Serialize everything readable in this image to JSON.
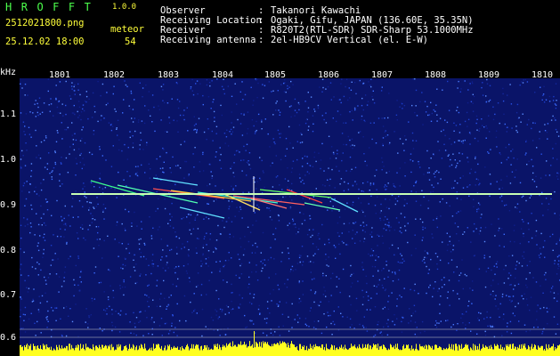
{
  "header": {
    "logo": "HROFFT",
    "version": "1.0.0",
    "filename": "2512021800.png",
    "datetime": "25.12.02 18:00",
    "meteor_label": "meteor",
    "meteor_count": "54",
    "fields": [
      {
        "label": "Observer",
        "value": "Takanori Kawachi"
      },
      {
        "label": "Receiving Location",
        "value": "Ogaki, Gifu, JAPAN (136.60E, 35.35N)"
      },
      {
        "label": "Receiver",
        "value": "R820T2(RTL-SDR) SDR-Sharp 53.1000MHz"
      },
      {
        "label": "Receiving antenna",
        "value": "2el-HB9CV Vertical (el. E-W)"
      }
    ]
  },
  "axis": {
    "unit": "kHz",
    "time_labels": [
      "1801",
      "1802",
      "1803",
      "1804",
      "1805",
      "1806",
      "1807",
      "1808",
      "1809",
      "1810"
    ],
    "freq_labels": [
      "1.1",
      "1.0",
      "0.9",
      "0.8",
      "0.7",
      "0.6"
    ]
  },
  "colors": {
    "background": "#0a1468",
    "carrier": "#c8ffb4",
    "signal_bar": "#ffff20",
    "label_text": "#ffffff",
    "header_yellow": "#ffff3a",
    "logo_green": "#4cff4c"
  }
}
